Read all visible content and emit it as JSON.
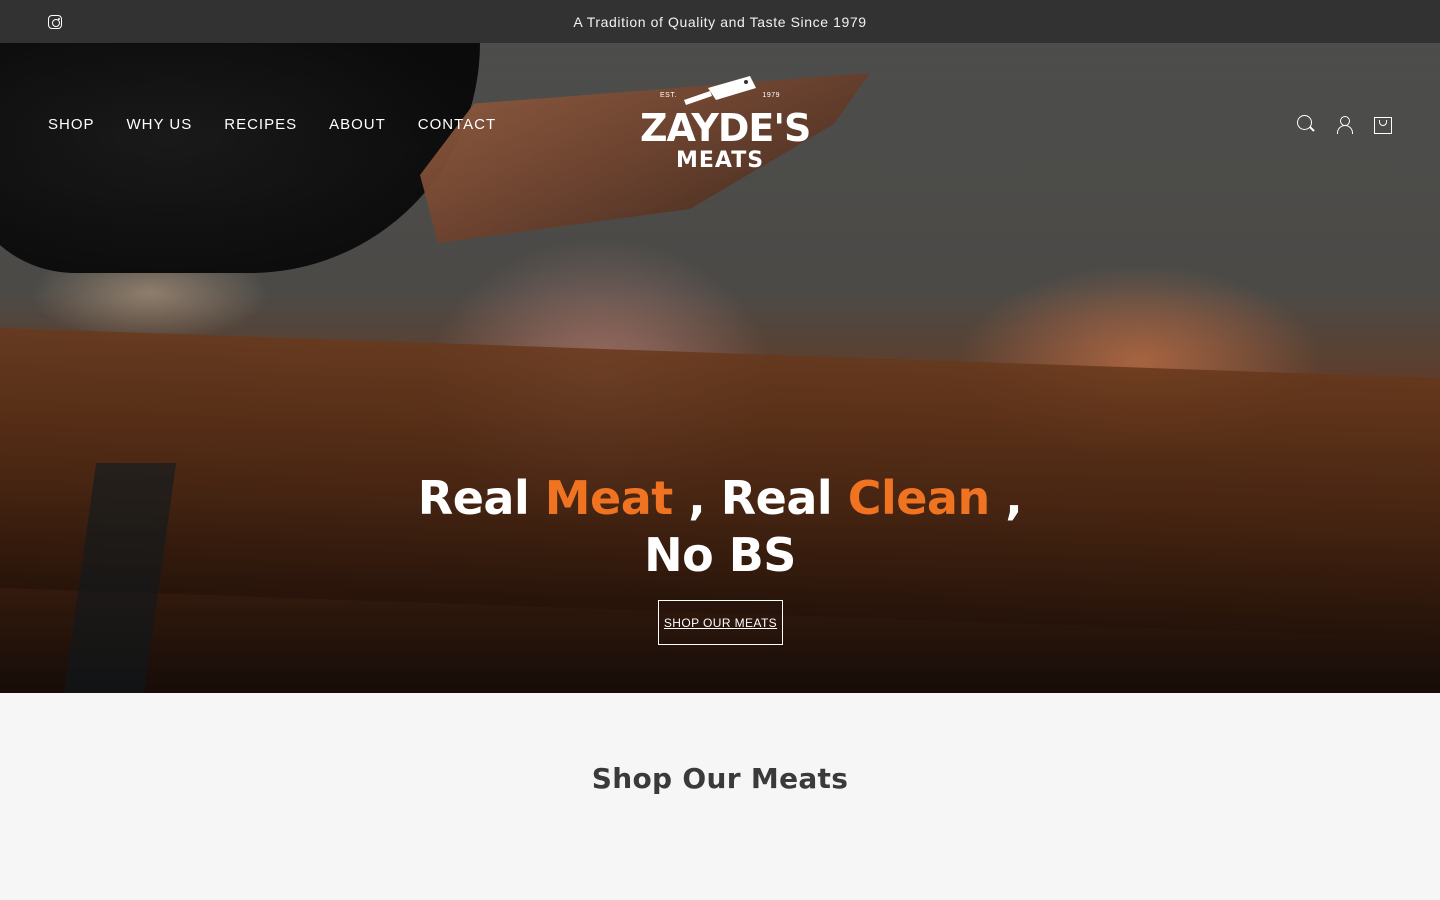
{
  "announcement": {
    "text": "A Tradition of Quality and Taste Since 1979",
    "social_icon": "instagram-icon"
  },
  "nav": {
    "items": [
      {
        "label": "SHOP"
      },
      {
        "label": "WHY US"
      },
      {
        "label": "RECIPES"
      },
      {
        "label": "ABOUT"
      },
      {
        "label": "CONTACT"
      }
    ]
  },
  "logo": {
    "est": "EST.",
    "year": "1979",
    "name": "ZAYDE'S",
    "sub": "MEATS"
  },
  "header_icons": [
    "search-icon",
    "account-icon",
    "cart-icon"
  ],
  "hero": {
    "line1": [
      {
        "text": "Real ",
        "highlight": false
      },
      {
        "text": "Meat",
        "highlight": true
      },
      {
        "text": " , Real ",
        "highlight": false
      },
      {
        "text": "Clean",
        "highlight": true
      },
      {
        "text": " ,",
        "highlight": false
      }
    ],
    "line2": "No BS",
    "cta_label": "SHOP OUR MEATS"
  },
  "section": {
    "title": "Shop Our Meats"
  },
  "colors": {
    "accent": "#f07322",
    "announcement_bg": "#333232",
    "page_bg": "#f6f6f6",
    "heading_text": "#3a3a3a"
  }
}
